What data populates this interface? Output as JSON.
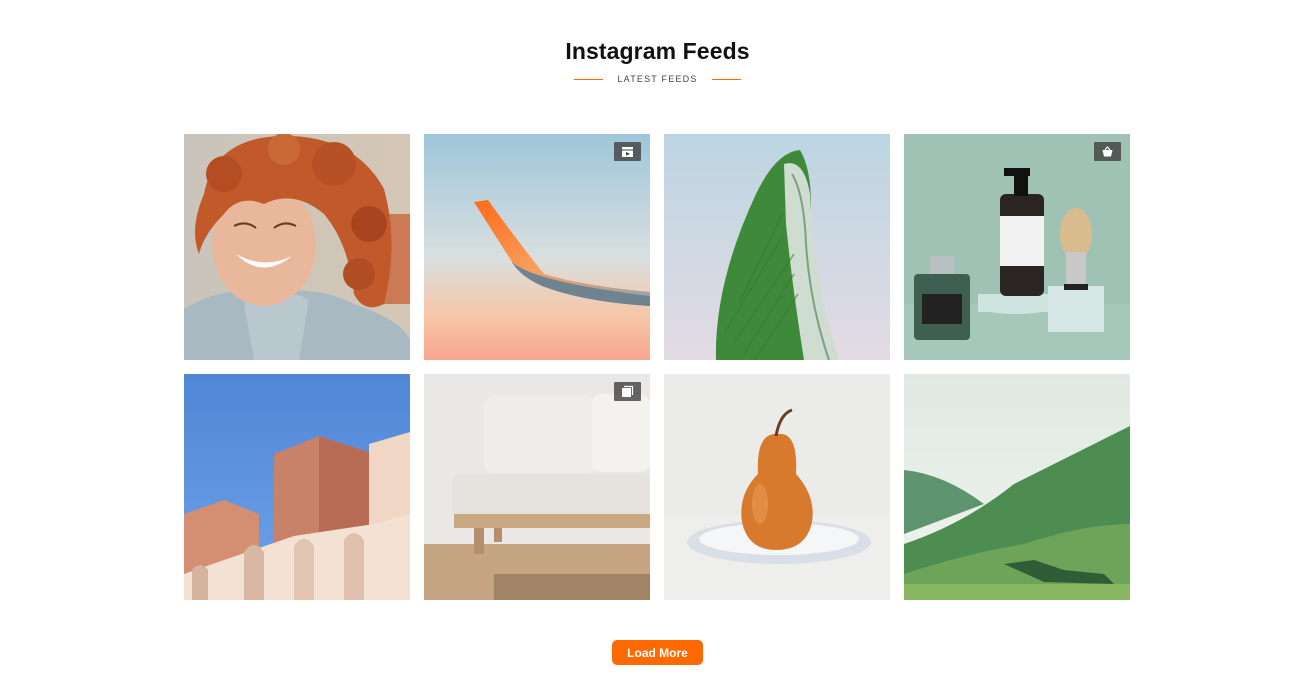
{
  "header": {
    "title": "Instagram Feeds",
    "subtitle": "LATEST FEEDS"
  },
  "colors": {
    "accent": "#ff6a00",
    "badge_bg": "#3c3c3c"
  },
  "feed": {
    "items": [
      {
        "subject": "smiling woman with curly red hair",
        "badge": null
      },
      {
        "subject": "airplane wing against sunset sky",
        "badge": "video-icon"
      },
      {
        "subject": "green banana leaf",
        "badge": null
      },
      {
        "subject": "cosmetic bottles and shaving brush",
        "badge": "shopping-bag-icon"
      },
      {
        "subject": "terracotta building with arches",
        "badge": null
      },
      {
        "subject": "white sofa with cushions",
        "badge": "carousel-icon"
      },
      {
        "subject": "orange pear on a white plate",
        "badge": null
      },
      {
        "subject": "green mountain landscape",
        "badge": null
      }
    ]
  },
  "actions": {
    "load_more_label": "Load More"
  }
}
